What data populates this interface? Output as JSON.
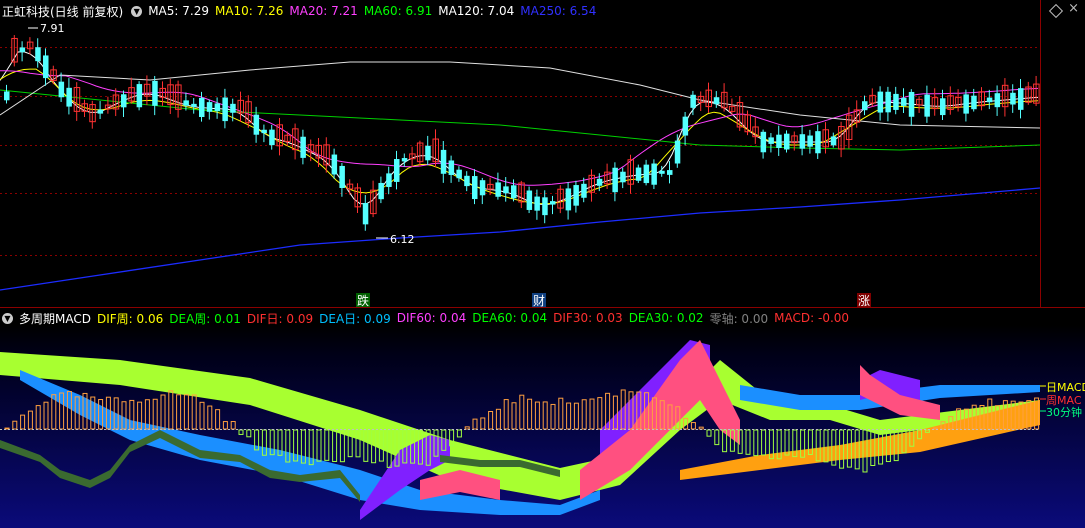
{
  "title": "正虹科技(日线 前复权)",
  "ma_labels": [
    {
      "text": "MA5: 7.29",
      "color": "#ffffff"
    },
    {
      "text": "MA10: 7.26",
      "color": "#ffff00"
    },
    {
      "text": "MA20: 7.21",
      "color": "#ff40ff"
    },
    {
      "text": "MA60: 6.91",
      "color": "#00ff00"
    },
    {
      "text": "MA120: 7.04",
      "color": "#ffffff"
    },
    {
      "text": "MA250: 6.54",
      "color": "#3030ff"
    }
  ],
  "price_high_label": "7.91",
  "price_low_label": "6.12",
  "markers": {
    "die": "跌",
    "cai": "财",
    "zhang": "涨"
  },
  "macd_title": "多周期MACD",
  "macd_labels": [
    {
      "text": "DIF周: 0.06",
      "color": "#ffff00"
    },
    {
      "text": "DEA周: 0.01",
      "color": "#00ff00"
    },
    {
      "text": "DIF日: 0.09",
      "color": "#ff3030"
    },
    {
      "text": "DEA日: 0.09",
      "color": "#00c0ff"
    },
    {
      "text": "DIF60: 0.04",
      "color": "#ff40ff"
    },
    {
      "text": "DEA60: 0.04",
      "color": "#00ff00"
    },
    {
      "text": "DIF30: 0.03",
      "color": "#ff3030"
    },
    {
      "text": "DEA30: 0.02",
      "color": "#00ff00"
    },
    {
      "text": "零轴: 0.00",
      "color": "#808080"
    },
    {
      "text": "MACD: -0.00",
      "color": "#ff3030"
    }
  ],
  "right_labels": {
    "day": "日MACD",
    "week": "周MAC",
    "m30": "30分钟"
  },
  "colors": {
    "up": "#ff3232",
    "down": "#54ffff",
    "grid": "#8b0000",
    "ma250": "#1c2cff",
    "ma60": "#00d000",
    "ma120": "#e0e0e0",
    "ma20": "#ff40ff",
    "ma10": "#ffff00",
    "ma5": "#ffffff"
  },
  "icons": [
    "chevron-down-icon",
    "diamond-icon",
    "close-icon"
  ]
}
